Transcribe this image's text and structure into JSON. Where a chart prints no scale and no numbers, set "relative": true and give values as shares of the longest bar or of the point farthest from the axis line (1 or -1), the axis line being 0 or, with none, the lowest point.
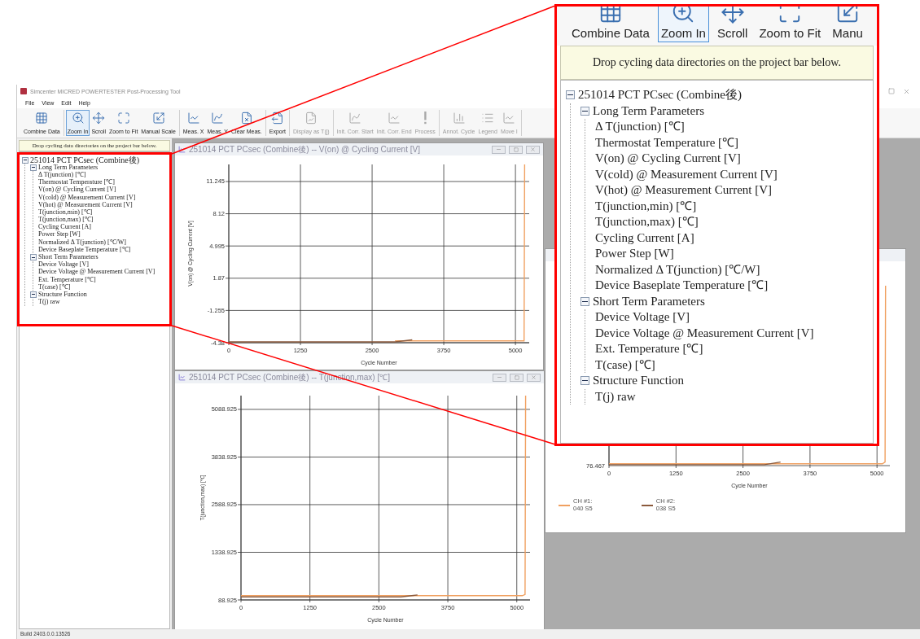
{
  "app": {
    "title": "Simcenter MICRED POWERTESTER Post-Processing Tool",
    "menu": [
      "File",
      "View",
      "Edit",
      "Help"
    ],
    "toolbar": [
      [
        {
          "label": "Combine Data",
          "selected": false,
          "disabled": false
        }
      ],
      [
        {
          "label": "Zoom In",
          "selected": true,
          "disabled": false
        },
        {
          "label": "Scroll",
          "selected": false,
          "disabled": false
        },
        {
          "label": "Zoom to Fit",
          "selected": false,
          "disabled": false
        },
        {
          "label": "Manual Scale",
          "selected": false,
          "disabled": false
        }
      ],
      [
        {
          "label": "Meas. X",
          "selected": false,
          "disabled": false
        },
        {
          "label": "Meas. Y",
          "selected": false,
          "disabled": false
        },
        {
          "label": "Clear Meas.",
          "selected": false,
          "disabled": false
        }
      ],
      [
        {
          "label": "Export",
          "selected": false,
          "disabled": false
        }
      ],
      [
        {
          "label": "Display as T(j)",
          "selected": false,
          "disabled": true
        }
      ],
      [
        {
          "label": "Init. Corr. Start",
          "selected": false,
          "disabled": true
        },
        {
          "label": "Init. Corr. End",
          "selected": false,
          "disabled": true
        },
        {
          "label": "Process",
          "selected": false,
          "disabled": true
        }
      ],
      [
        {
          "label": "Annot. Cycle",
          "selected": false,
          "disabled": true
        },
        {
          "label": "Legend",
          "selected": false,
          "disabled": true
        },
        {
          "label": "Move l",
          "selected": false,
          "disabled": true
        }
      ]
    ],
    "left_panel": {
      "note": "Drop cycling data directories on the project bar below.",
      "tree": [
        {
          "label": "251014 PCT PCsec (Combine後)",
          "expanded": true,
          "children": [
            {
              "label": "Long Term Parameters",
              "expanded": true,
              "children": [
                {
                  "label": "Δ T(junction) [℃]"
                },
                {
                  "label": "Thermostat Temperature [℃]"
                },
                {
                  "label": "V(on) @ Cycling Current [V]"
                },
                {
                  "label": "V(cold) @ Measurement Current [V]"
                },
                {
                  "label": "V(hot) @ Measurement Current [V]"
                },
                {
                  "label": "T(junction,min) [℃]"
                },
                {
                  "label": "T(junction,max) [℃]"
                },
                {
                  "label": "Cycling Current [A]"
                },
                {
                  "label": "Power Step [W]"
                },
                {
                  "label": "Normalized Δ T(junction) [℃/W]"
                },
                {
                  "label": "Device Baseplate Temperature [℃]"
                }
              ]
            },
            {
              "label": "Short Term Parameters",
              "expanded": true,
              "children": [
                {
                  "label": "Device Voltage [V]"
                },
                {
                  "label": "Device Voltage @ Measurement Current [V]"
                },
                {
                  "label": "Ext. Temperature [℃]"
                },
                {
                  "label": "T(case) [℃]"
                }
              ]
            },
            {
              "label": "Structure Function",
              "expanded": true,
              "children": [
                {
                  "label": "T(j) raw"
                }
              ]
            }
          ]
        }
      ]
    },
    "windows": [
      {
        "title": "251014 PCT PCsec (Combine後) -- V(on) @ Cycling Current [V]",
        "chart_data": {
          "type": "line",
          "xlabel": "Cycle Number",
          "ylabel": "V(on) @ Cycling Current [V]",
          "grid": true,
          "x": [
            0,
            2900,
            3200,
            5100,
            5150,
            5160
          ],
          "xlim": [
            0,
            5240
          ],
          "ylim": [
            -4.38,
            12.9
          ],
          "xticks": [
            0,
            1250,
            2500,
            3750,
            5000
          ],
          "yticks": [
            -4.38,
            -1.255,
            1.87,
            4.995,
            8.12,
            11.245
          ],
          "series": [
            {
              "color": "#f0a060",
              "values": [
                null,
                -4.2,
                -4.2,
                -4.2,
                -4.2,
                12.9
              ]
            },
            {
              "color": "#8b5a3c",
              "values": [
                -4.3,
                -4.3,
                -4.1,
                null,
                null,
                null
              ]
            }
          ]
        }
      },
      {
        "title": "251014 PCT PCsec (Combine後) -- T(junction,max) [℃]",
        "chart_data": {
          "type": "line",
          "xlabel": "Cycle Number",
          "ylabel": "T(junction,max) [℃]",
          "grid": true,
          "x": [
            0,
            2900,
            3200,
            5100,
            5150,
            5160
          ],
          "xlim": [
            0,
            5240
          ],
          "ylim": [
            88.925,
            5450
          ],
          "xticks": [
            0,
            1250,
            2500,
            3750,
            5000
          ],
          "yticks": [
            88.925,
            1338.925,
            2588.925,
            3838.925,
            5088.925
          ],
          "series": [
            {
              "color": "#f0a060",
              "values": [
                200,
                200,
                200,
                200,
                230,
                5450
              ]
            },
            {
              "color": "#8b5a3c",
              "values": [
                170,
                170,
                220,
                null,
                null,
                null
              ]
            }
          ]
        }
      },
      {
        "chart_data": {
          "type": "line",
          "xlabel": "Cycle Number",
          "grid": true,
          "relative": true,
          "x": [
            0,
            2900,
            3200,
            5100,
            5150,
            5160
          ],
          "xlim": [
            0,
            5240
          ],
          "xticks": [
            0,
            1250,
            2500,
            3750,
            5000
          ],
          "annotations": [
            "76.467"
          ],
          "series": [
            {
              "color": "#f0a060",
              "values": [
                0.01,
                0.01,
                0.01,
                0.01,
                0.02,
                1
              ]
            },
            {
              "color": "#8b5a3c",
              "values": [
                0.005,
                0.005,
                0.02,
                null,
                null,
                null
              ]
            }
          ]
        },
        "legend": [
          {
            "name": "CH #1:",
            "sample": "040 S5",
            "color": "#f0a060"
          },
          {
            "name": "CH #2:",
            "sample": "038 S5",
            "color": "#8b5a3c"
          }
        ]
      }
    ],
    "status_bar": "Build 2403.0.0.13526"
  },
  "callout": {
    "toolbar": [
      {
        "label": "Combine Data",
        "selected": false
      },
      {
        "label": "Zoom In",
        "selected": true
      },
      {
        "label": "Scroll",
        "selected": false
      },
      {
        "label": "Zoom to Fit",
        "selected": false
      },
      {
        "label": "Manu",
        "selected": false
      }
    ],
    "note": "Drop cycling data directories on the project bar below.",
    "tree": [
      {
        "label": "251014 PCT PCsec (Combine後)",
        "expanded": true,
        "children": [
          {
            "label": "Long Term Parameters",
            "expanded": true,
            "children": [
              {
                "label": "Δ T(junction) [℃]"
              },
              {
                "label": "Thermostat Temperature [℃]"
              },
              {
                "label": "V(on) @ Cycling Current [V]"
              },
              {
                "label": "V(cold) @ Measurement Current [V]"
              },
              {
                "label": "V(hot) @ Measurement Current [V]"
              },
              {
                "label": "T(junction,min) [℃]"
              },
              {
                "label": "T(junction,max) [℃]"
              },
              {
                "label": "Cycling Current [A]"
              },
              {
                "label": "Power Step [W]"
              },
              {
                "label": "Normalized Δ T(junction) [℃/W]"
              },
              {
                "label": "Device Baseplate Temperature [℃]"
              }
            ]
          },
          {
            "label": "Short Term Parameters",
            "expanded": true,
            "children": [
              {
                "label": "Device Voltage [V]"
              },
              {
                "label": "Device Voltage @ Measurement Current [V]"
              },
              {
                "label": "Ext. Temperature [℃]"
              },
              {
                "label": "T(case) [℃]"
              }
            ]
          },
          {
            "label": "Structure Function",
            "expanded": true,
            "children": [
              {
                "label": "T(j) raw"
              }
            ]
          }
        ]
      }
    ]
  }
}
